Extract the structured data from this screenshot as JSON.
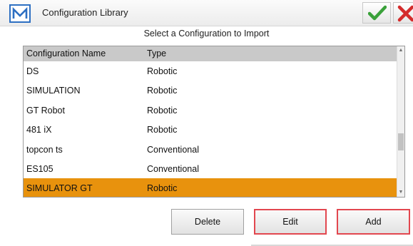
{
  "window": {
    "title": "Configuration Library",
    "ok_icon": "checkmark-icon",
    "close_icon": "close-icon",
    "logo_icon": "m-logo-icon",
    "accent_color": "#e8920d",
    "ok_color": "#3aa13a",
    "close_color": "#d42b2b"
  },
  "dialog": {
    "subtitle": "Select a Configuration to Import"
  },
  "table": {
    "columns": [
      "Configuration Name",
      "Type"
    ],
    "rows": [
      {
        "name": "DS",
        "type": "Robotic",
        "selected": false
      },
      {
        "name": "SIMULATION",
        "type": "Robotic",
        "selected": false
      },
      {
        "name": "GT Robot",
        "type": "Robotic",
        "selected": false
      },
      {
        "name": "481 iX",
        "type": "Robotic",
        "selected": false
      },
      {
        "name": "topcon ts",
        "type": "Conventional",
        "selected": false
      },
      {
        "name": "ES105",
        "type": "Conventional",
        "selected": false
      },
      {
        "name": "SIMULATOR GT",
        "type": "Robotic",
        "selected": true
      }
    ],
    "selected_index": 6
  },
  "buttons": {
    "delete": "Delete",
    "edit": "Edit",
    "add": "Add"
  }
}
